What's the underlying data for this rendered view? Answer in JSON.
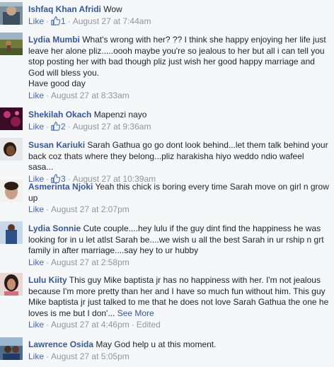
{
  "comments": [
    {
      "author": "Ishfaq Khan Afridi",
      "text": "Wow",
      "like": "Like",
      "likes": "1",
      "date": "August 27 at 7:44am",
      "avatar": "avatar-1"
    },
    {
      "author": "Lydia Mumbi",
      "text": "What's wrong with her? ?? I think she happy enjoying her life just leave her alone pliz.....oooh maybe you're so jealous to her but all i can tell you stop posting her with bad though pliz just wish her good happy marriage and God will bless you.",
      "text2": "Have good day",
      "like": "Like",
      "date": "August 27 at 8:33am",
      "avatar": "avatar-2"
    },
    {
      "author": "Shekilah Okach",
      "text": "Mapenzi nayo",
      "like": "Like",
      "likes": "2",
      "date": "August 27 at 9:36am",
      "avatar": "avatar-3"
    },
    {
      "author": "Susan Kariuki",
      "text": "Sarah Gathua go go dont look behind...let them talk behind your back coz thats where they belong...pliz harakisha hiyo weddo ndio wafeel sasa...",
      "like": "Like",
      "likes": "3",
      "date": "August 27 at 10:39am",
      "avatar": "avatar-4"
    },
    {
      "author": "Asmerinta Njoki",
      "text": "Yeah this chick is boring every time Sarah move on girl n grow up",
      "like": "Like",
      "date": "August 27 at 2:07pm",
      "avatar": "avatar-5"
    },
    {
      "author": "Lydia Sonnie",
      "text": "Cute couple....hey lulu if the guy dint find the happiness he was looking for in u let atlst Sarah be....we wish u all the best Sarah in ur rship n grt family in after marriage....say hey to ur hubby",
      "like": "Like",
      "date": "August 27 at 2:58pm",
      "avatar": "avatar-6"
    },
    {
      "author": "Lulu Kiity",
      "text": "This guy Mike baptista jr has no happiness with her. I'm not jealous because I'm more pretty than her and I have so much fun without him. This guy Mike baptista jr just talked to me that he does not love Sarah Gathua the one he loves is me but I don'...",
      "see_more": "See More",
      "like": "Like",
      "date": "August 27 at 4:46pm",
      "edited": "Edited",
      "avatar": "avatar-7"
    },
    {
      "author": "Lawrence Osida",
      "text": "May God help u at this moment.",
      "like": "Like",
      "date": "August 27 at 5:05pm",
      "avatar": "avatar-8"
    }
  ],
  "separator": "·",
  "colors": {
    "link": "#365899",
    "like": "#4267b2",
    "meta": "#90949c",
    "background": "#f6f7f9"
  },
  "icons": {
    "like": "thumbs-up-icon"
  }
}
